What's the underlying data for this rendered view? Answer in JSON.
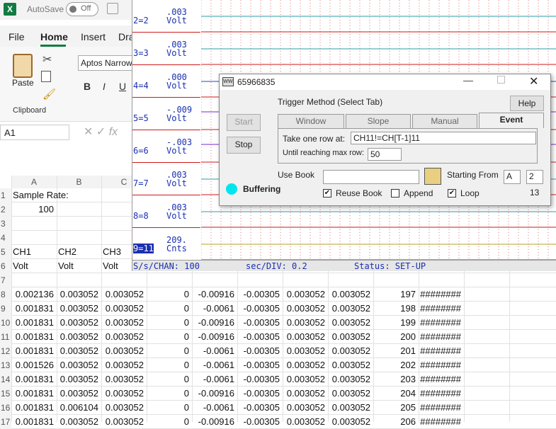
{
  "excel": {
    "logo": "X",
    "autosave_label": "AutoSave",
    "autosave_state": "Off",
    "menu": [
      "File",
      "Home",
      "Insert",
      "Dra"
    ],
    "ribbon": {
      "paste": "Paste",
      "clipboard": "Clipboard",
      "font_name": "Aptos Narrow",
      "bold": "B",
      "italic": "I",
      "underline": "U"
    },
    "name_box": "A1",
    "fx": "fx",
    "columns": [
      "A",
      "B",
      "C"
    ],
    "row_numbers": [
      "1",
      "2",
      "3",
      "4",
      "5",
      "6",
      "7",
      "8",
      "9",
      "10",
      "11",
      "12",
      "13",
      "14",
      "15",
      "16",
      "17"
    ],
    "top_cells": {
      "a1": "Sample Rate:",
      "a2": "100",
      "a5": "CH1",
      "b5": "CH2",
      "c5": "CH3",
      "a6": "Volt",
      "b6": "Volt",
      "c6": "Volt"
    },
    "data_rows": [
      [
        "0.002136",
        "0.003052",
        "0.003052",
        "0",
        "-0.00916",
        "-0.00305",
        "0.003052",
        "0.003052",
        "197",
        "########"
      ],
      [
        "0.001831",
        "0.003052",
        "0.003052",
        "0",
        "-0.0061",
        "-0.00305",
        "0.003052",
        "0.003052",
        "198",
        "########"
      ],
      [
        "0.001831",
        "0.003052",
        "0.003052",
        "0",
        "-0.00916",
        "-0.00305",
        "0.003052",
        "0.003052",
        "199",
        "########"
      ],
      [
        "0.001831",
        "0.003052",
        "0.003052",
        "0",
        "-0.00916",
        "-0.00305",
        "0.003052",
        "0.003052",
        "200",
        "########"
      ],
      [
        "0.001831",
        "0.003052",
        "0.003052",
        "0",
        "-0.0061",
        "-0.00305",
        "0.003052",
        "0.003052",
        "201",
        "########"
      ],
      [
        "0.001526",
        "0.003052",
        "0.003052",
        "0",
        "-0.0061",
        "-0.00305",
        "0.003052",
        "0.003052",
        "202",
        "########"
      ],
      [
        "0.001831",
        "0.003052",
        "0.003052",
        "0",
        "-0.0061",
        "-0.00305",
        "0.003052",
        "0.003052",
        "203",
        "########"
      ],
      [
        "0.001831",
        "0.003052",
        "0.003052",
        "0",
        "-0.00916",
        "-0.00305",
        "0.003052",
        "0.003052",
        "204",
        "########"
      ],
      [
        "0.001831",
        "0.006104",
        "0.003052",
        "0",
        "-0.0061",
        "-0.00305",
        "0.003052",
        "0.003052",
        "205",
        "########"
      ],
      [
        "0.001831",
        "0.003052",
        "0.003052",
        "0",
        "-0.00916",
        "-0.00305",
        "0.003052",
        "0.003052",
        "206",
        "########"
      ]
    ]
  },
  "scope": {
    "channels": [
      {
        "label": "2=2",
        "value": ".003",
        "unit": "Volt"
      },
      {
        "label": "3=3",
        "value": ".003",
        "unit": "Volt"
      },
      {
        "label": "4=4",
        "value": ".000",
        "unit": "Volt"
      },
      {
        "label": "5=5",
        "value": "-.009",
        "unit": "Volt"
      },
      {
        "label": "6=6",
        "value": "-.003",
        "unit": "Volt"
      },
      {
        "label": "7=7",
        "value": ".003",
        "unit": "Volt"
      },
      {
        "label": "8=8",
        "value": ".003",
        "unit": "Volt"
      },
      {
        "label": "9=11",
        "value": "209.",
        "unit": "Cnts"
      }
    ],
    "trace_colors": [
      "#2a9fa8",
      "#2a9fa8",
      "#1a4fc0",
      "#7a2ad0",
      "#7a2ad0",
      "#2a9fa8",
      "#2a9fa8",
      "#b8a020"
    ],
    "status": {
      "rate": "S/s/CHAN: 100",
      "sec_div": "sec/DIV: 0.2",
      "state": "Status: SET-UP"
    }
  },
  "dialog": {
    "title": "65966835",
    "method_label": "Trigger Method (Select Tab)",
    "help": "Help",
    "start": "Start",
    "stop": "Stop",
    "tabs": [
      "Window",
      "Slope",
      "Manual",
      "Event"
    ],
    "take_one_row_label": "Take one row at:",
    "take_one_row_value": "CH11!=CH[T-1]11",
    "max_row_label": "Until reaching max row:",
    "max_row_value": "50",
    "buffering": "Buffering",
    "use_book_label": "Use Book",
    "use_book_value": "",
    "starting_from_label": "Starting From",
    "start_col": "A",
    "start_row": "2",
    "reuse_book": "Reuse Book",
    "append": "Append",
    "loop": "Loop",
    "counter": "13",
    "check_mark": "✔"
  }
}
